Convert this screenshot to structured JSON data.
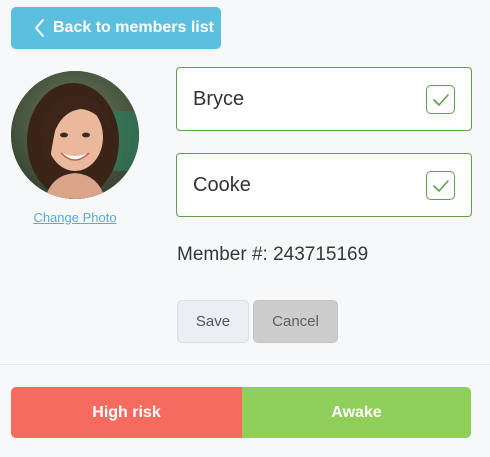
{
  "header": {
    "back_label": "Back to members list"
  },
  "profile": {
    "change_photo_label": "Change Photo"
  },
  "form": {
    "first_name": "Bryce",
    "last_name": "Cooke",
    "member_label": "Member #:",
    "member_number": "243715169"
  },
  "actions": {
    "save_label": "Save",
    "cancel_label": "Cancel"
  },
  "status": {
    "risk_label": "High risk",
    "awake_label": "Awake",
    "risk_color": "#f56b5f",
    "awake_color": "#8fcf5a"
  },
  "colors": {
    "back_button": "#5bc0de",
    "field_border": "#5f9f4e",
    "link": "#5aaad6"
  }
}
